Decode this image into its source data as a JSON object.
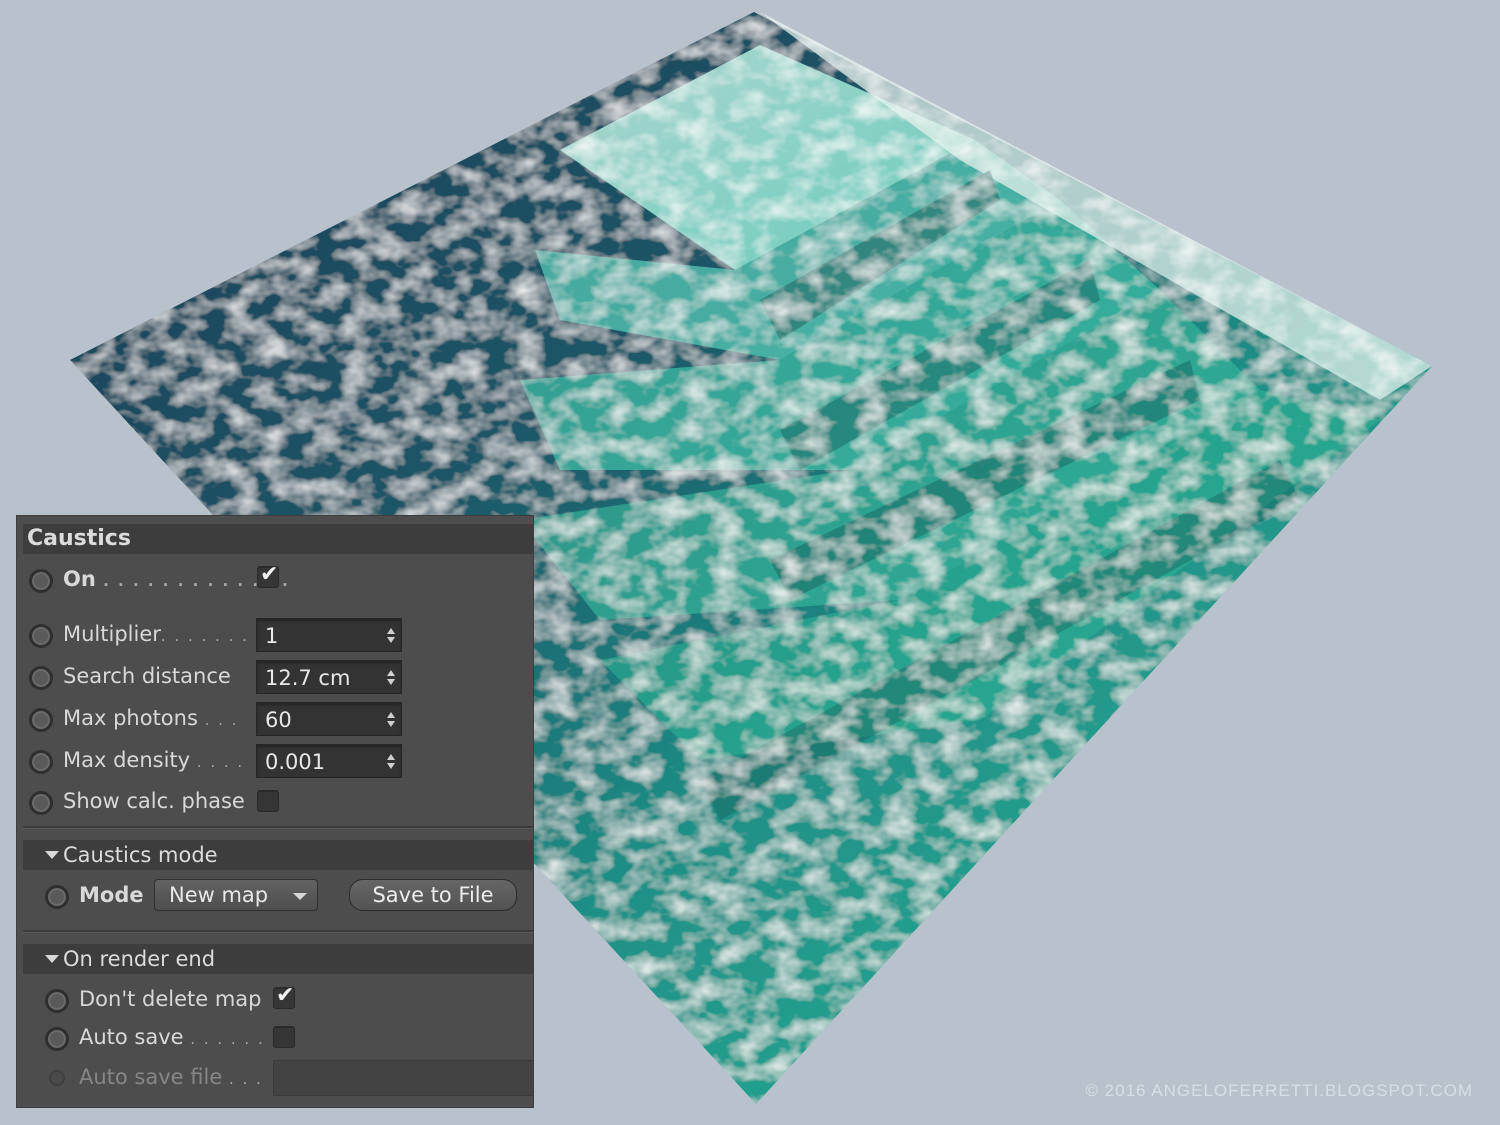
{
  "panel": {
    "title": "Caustics",
    "on_label": "On",
    "on_checked": true,
    "multiplier_label": "Multiplier",
    "multiplier_value": "1",
    "search_distance_label": "Search distance",
    "search_distance_value": "12.7 cm",
    "max_photons_label": "Max photons",
    "max_photons_value": "60",
    "max_density_label": "Max density",
    "max_density_value": "0.001",
    "show_calc_label": "Show calc. phase",
    "show_calc_checked": false,
    "caustics_mode_group": "Caustics mode",
    "mode_label": "Mode",
    "mode_value": "New map",
    "save_button": "Save to File",
    "render_end_group": "On render end",
    "dont_delete_label": "Don't delete map",
    "dont_delete_checked": true,
    "auto_save_label": "Auto save",
    "auto_save_checked": false,
    "auto_save_file_label": "Auto save file"
  },
  "credit": "© 2016 ANGELOFERRETTI.BLOGSPOT.COM",
  "colors": {
    "background": "#b7c2cd",
    "panel_bg": "#4d4d4d",
    "water_deep": "#1f4f60",
    "water_light": "#3ed6b4",
    "water_shallow": "#d9ece6"
  }
}
